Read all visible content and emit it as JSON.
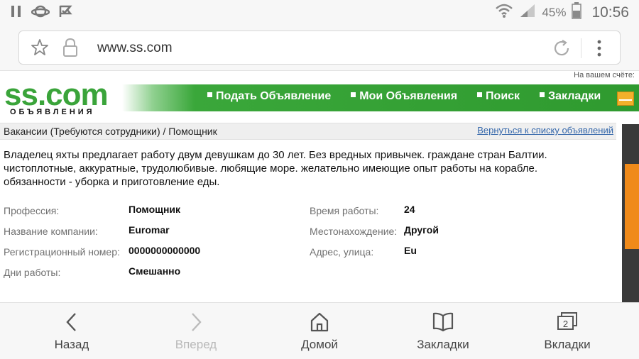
{
  "status_bar": {
    "battery_percent": "45%",
    "time": "10:56",
    "icons": [
      "pause-icon",
      "planet-icon",
      "check-flag-icon",
      "wifi-icon",
      "signal-icon",
      "battery-icon"
    ]
  },
  "address_bar": {
    "url": "www.ss.com"
  },
  "site": {
    "account_label": "На вашем счёте:",
    "logo_text": "ss.com",
    "logo_sub": "ОБЪЯВЛЕНИЯ",
    "nav": [
      {
        "label": "Подать Объявление"
      },
      {
        "label": "Мои Объявления"
      },
      {
        "label": "Поиск"
      },
      {
        "label": "Закладки"
      }
    ],
    "colors": {
      "brand_green": "#3aa43a",
      "link": "#3366aa"
    }
  },
  "listing": {
    "breadcrumb": "Вакансии (Требуются сотрудники) / Помощник",
    "back_link": "Вернуться к списку объявлений",
    "description_lines": [
      "Владелец яхты предлагает работу двум девушкам до 30 лет. Без вредных привычек. граждане стран Балтии.",
      "чистоплотные, аккуратные, трудолюбивые. любящие море. желательно имеющие опыт работы на корабле.",
      "обязанности - уборка и приготовление еды."
    ],
    "fields_left": [
      {
        "label": "Профессия:",
        "value": "Помощник"
      },
      {
        "label": "Название компании:",
        "value": "Euromar"
      },
      {
        "label": "Регистрационный номер:",
        "value": "0000000000000"
      },
      {
        "label": "Дни работы:",
        "value": "Смешанно"
      }
    ],
    "fields_right": [
      {
        "label": "Время работы:",
        "value": "24"
      },
      {
        "label": "Местонахождение:",
        "value": "Другой"
      },
      {
        "label": "Адрес, улица:",
        "value": "Eu"
      }
    ]
  },
  "toolbar": {
    "back": "Назад",
    "forward": "Вперед",
    "home": "Домой",
    "bookmarks": "Закладки",
    "tabs": "Вкладки",
    "tabs_count": "2"
  }
}
